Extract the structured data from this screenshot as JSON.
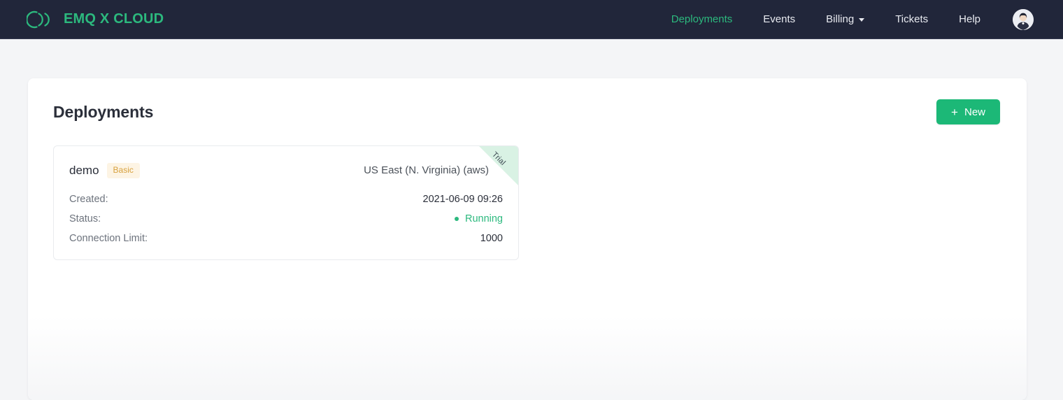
{
  "topbar": {
    "brand": {
      "name": "EMQ X CLOUD",
      "logo_icon": "emqx-arcs-logo-icon",
      "brand_color": "#2cb97e"
    },
    "nav_items": [
      {
        "label": "Deployments",
        "active": true,
        "has_caret": false
      },
      {
        "label": "Events",
        "active": false,
        "has_caret": false
      },
      {
        "label": "Billing",
        "active": false,
        "has_caret": true
      },
      {
        "label": "Tickets",
        "active": false,
        "has_caret": false
      },
      {
        "label": "Help",
        "active": false,
        "has_caret": false
      }
    ],
    "avatar": {
      "icon": "user-avatar-icon"
    },
    "background_color": "#21263a"
  },
  "panel": {
    "title": "Deployments",
    "new_button": {
      "label": "New",
      "plus": "+",
      "color": "#1cb877"
    }
  },
  "deployments": [
    {
      "name": "demo",
      "plan_badge": "Basic",
      "plan_badge_color": "#d7a13e",
      "region": "US East (N. Virginia) (aws)",
      "ribbon": "Trial",
      "ribbon_color": "#d9f2e4",
      "details": [
        {
          "label": "Created:",
          "value": "2021-06-09 09:26",
          "type": "text"
        },
        {
          "label": "Status:",
          "value": "Running",
          "type": "status",
          "status_color": "#2cb97e"
        },
        {
          "label": "Connection Limit:",
          "value": "1000",
          "type": "text"
        }
      ]
    }
  ]
}
